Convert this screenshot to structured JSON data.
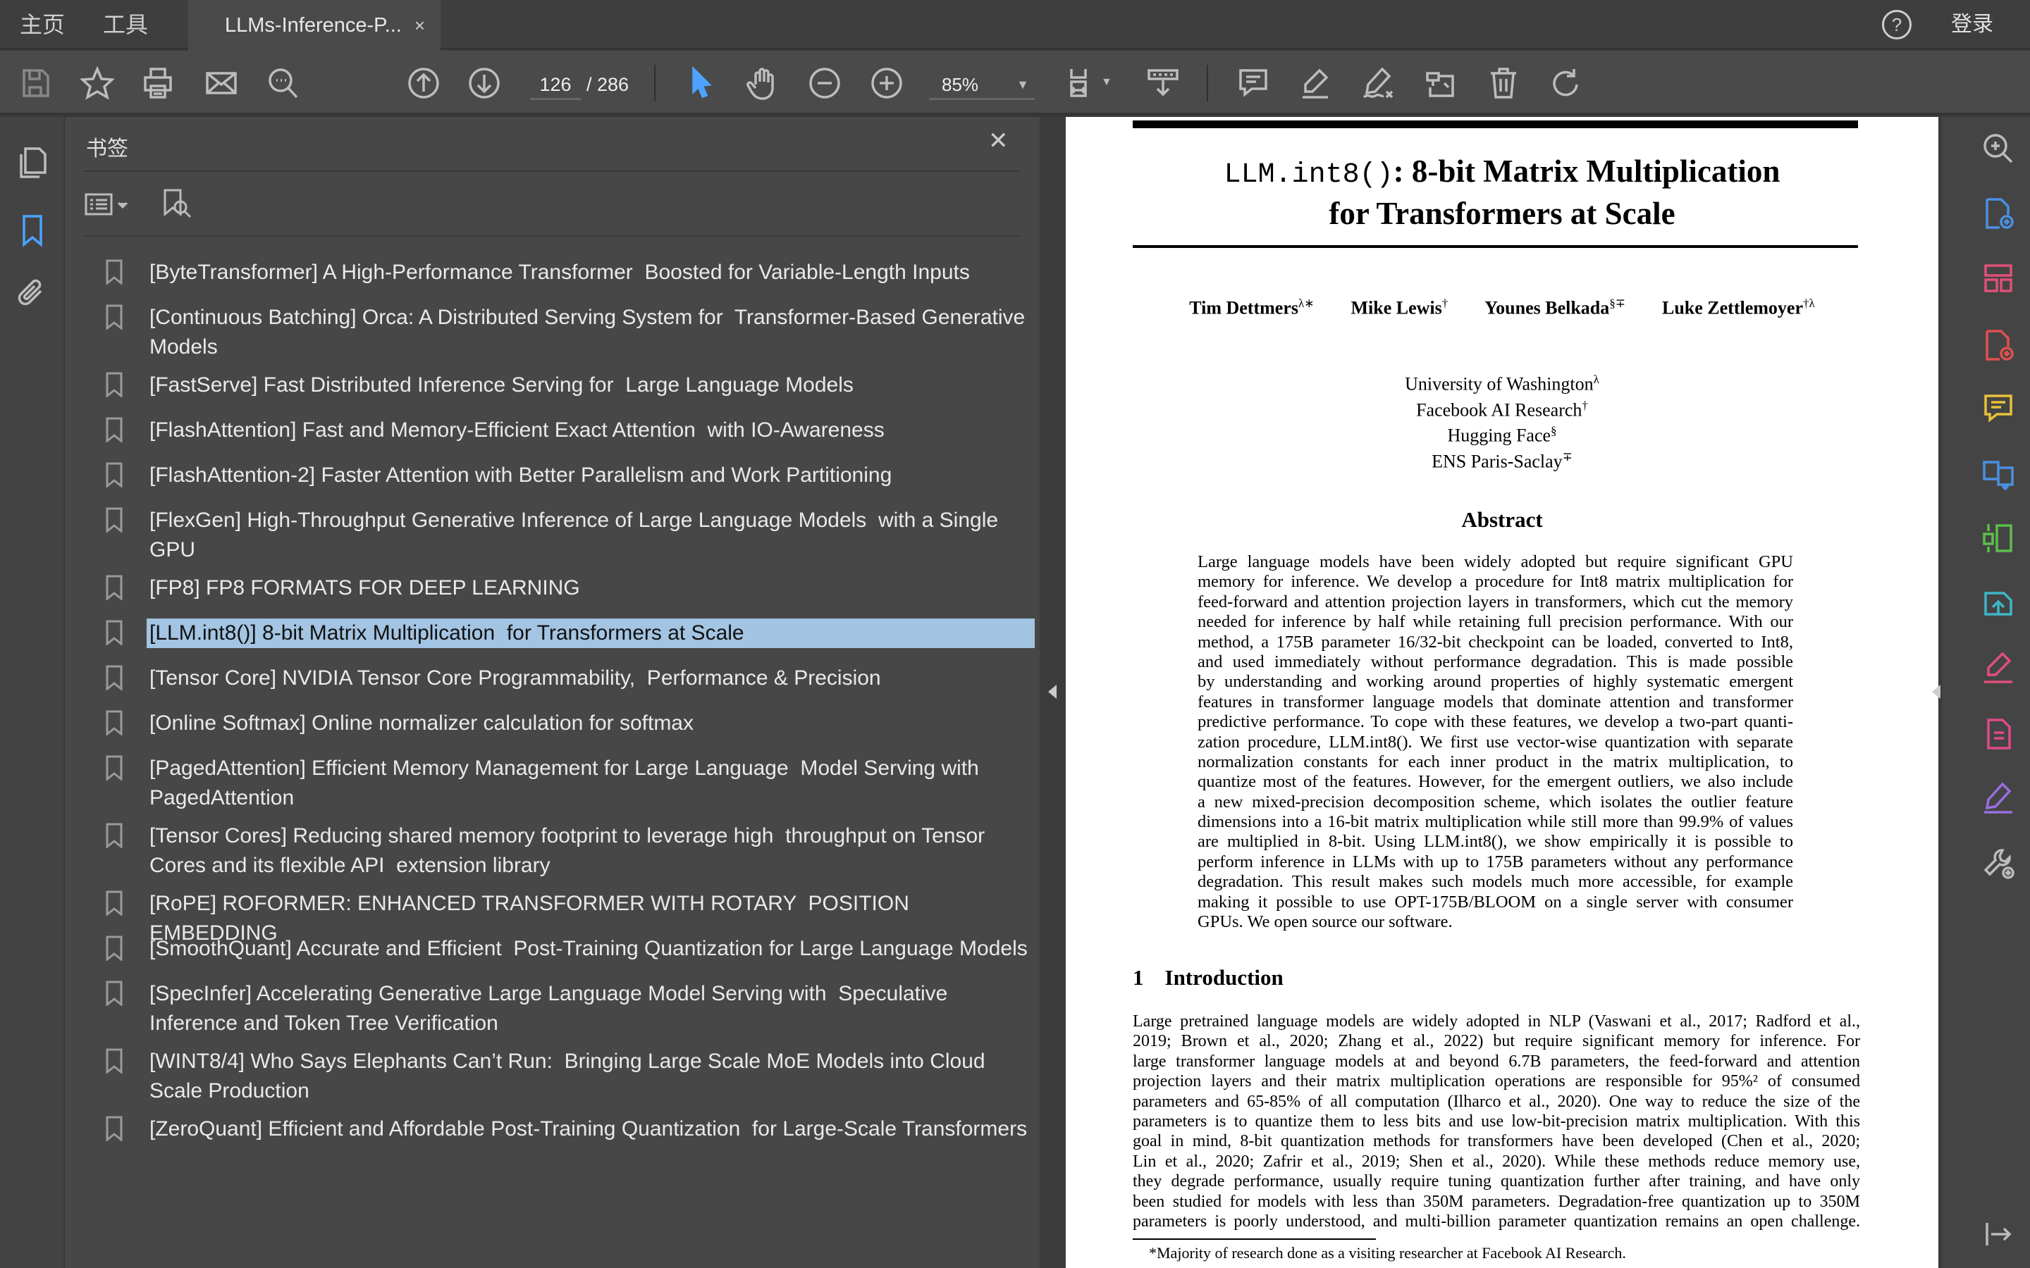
{
  "tabbar": {
    "home": "主页",
    "tools": "工具",
    "doc_tab": "LLMs-Inference-P...",
    "close": "×",
    "login": "登录"
  },
  "toolbar": {
    "page_current": "126",
    "page_total": "/ 286",
    "zoom": "85%"
  },
  "sidebar": {
    "title": "书签",
    "close": "✕",
    "items": [
      {
        "label": "[ByteTransformer] A High-Performance Transformer  Boosted for Variable-Length Inputs"
      },
      {
        "label": "[Continuous Batching] Orca: A Distributed Serving System for  Transformer-Based Generative Models"
      },
      {
        "label": "[FastServe] Fast Distributed Inference Serving for  Large Language Models"
      },
      {
        "label": "[FlashAttention] Fast and Memory-Efficient Exact Attention  with IO-Awareness"
      },
      {
        "label": "[FlashAttention-2] Faster Attention with Better Parallelism and Work Partitioning"
      },
      {
        "label": "[FlexGen] High-Throughput Generative Inference of Large Language Models  with a Single GPU"
      },
      {
        "label": "[FP8] FP8 FORMATS FOR DEEP LEARNING"
      },
      {
        "label": "[LLM.int8()] 8-bit Matrix Multiplication  for Transformers at Scale",
        "selected": true
      },
      {
        "label": "[Tensor Core] NVIDIA Tensor Core Programmability,  Performance & Precision"
      },
      {
        "label": "[Online Softmax] Online normalizer calculation for softmax"
      },
      {
        "label": "[PagedAttention] Efficient Memory Management for Large Language  Model Serving with PagedAttention"
      },
      {
        "label": "[Tensor Cores] Reducing shared memory footprint to leverage high  throughput on Tensor Cores and its flexible API  extension library"
      },
      {
        "label": "[RoPE] ROFORMER: ENHANCED TRANSFORMER WITH ROTARY  POSITION EMBEDDING"
      },
      {
        "label": "[SmoothQuant] Accurate and Efficient  Post-Training Quantization for Large Language Models"
      },
      {
        "label": "[SpecInfer] Accelerating Generative Large Language Model Serving with  Speculative Inference and Token Tree Verification"
      },
      {
        "label": "[WINT8/4] Who Says Elephants Can’t Run:  Bringing Large Scale MoE Models into Cloud Scale Production"
      },
      {
        "label": "[ZeroQuant] Efficient and Affordable Post-Training Quantization  for Large-Scale Transformers"
      }
    ]
  },
  "paper": {
    "title_mono": "LLM.int8()",
    "title_rest": ": 8-bit Matrix Multiplication",
    "title_line2": "for Transformers at Scale",
    "authors": [
      {
        "name": "Tim Dettmers",
        "sup": "λ∗"
      },
      {
        "name": "Mike Lewis",
        "sup": "†"
      },
      {
        "name": "Younes Belkada",
        "sup": "§∓"
      },
      {
        "name": "Luke Zettlemoyer",
        "sup": "†λ"
      }
    ],
    "affiliations": [
      {
        "name": "University of Washington",
        "sup": "λ"
      },
      {
        "name": "Facebook AI Research",
        "sup": "†"
      },
      {
        "name": "Hugging Face",
        "sup": "§"
      },
      {
        "name": "ENS Paris-Saclay",
        "sup": "∓"
      }
    ],
    "abstract_heading": "Abstract",
    "abstract_lines": [
      "Large language models have been widely adopted but require significant GPU",
      "memory for inference. We develop a procedure for Int8 matrix multiplication for",
      "feed-forward and attention projection layers in transformers, which cut the memory",
      "needed for inference by half while retaining full precision performance. With our",
      "method, a 175B parameter 16/32-bit checkpoint can be loaded, converted to Int8,",
      "and used immediately without performance degradation. This is made possible",
      "by understanding and working around properties of highly systematic emergent",
      "features in transformer language models that dominate attention and transformer",
      "predictive performance. To cope with these features, we develop a two-part quanti-",
      "zation procedure, LLM.int8(). We first use vector-wise quantization with separate",
      "normalization constants for each inner product in the matrix multiplication, to",
      "quantize most of the features. However, for the emergent outliers, we also include",
      "a new mixed-precision decomposition scheme, which isolates the outlier feature",
      "dimensions into a 16-bit matrix multiplication while still more than 99.9% of values",
      "are multiplied in 8-bit. Using LLM.int8(), we show empirically it is possible to",
      "perform inference in LLMs with up to 175B parameters without any performance",
      "degradation. This result makes such models much more accessible, for example",
      "making it possible to use OPT-175B/BLOOM on a single server with consumer",
      "GPUs. We open source our software."
    ],
    "intro_number": "1",
    "intro_heading": "Introduction",
    "intro_lines": [
      "Large pretrained language models are widely adopted in NLP (Vaswani et al., 2017; Radford et al.,",
      "2019; Brown et al., 2020; Zhang et al., 2022) but require significant memory for inference. For",
      "large transformer language models at and beyond 6.7B parameters, the feed-forward and attention",
      "projection layers and their matrix multiplication operations are responsible for 95%² of consumed",
      "parameters and 65-85% of all computation (Ilharco et al., 2020). One way to reduce the size of the",
      "parameters is to quantize them to less bits and use low-bit-precision matrix multiplication. With this",
      "goal in mind, 8-bit quantization methods for transformers have been developed (Chen et al., 2020;",
      "Lin et al., 2020; Zafrir et al., 2019; Shen et al., 2020). While these methods reduce memory use,",
      "they degrade performance, usually require tuning quantization further after training, and have only",
      "been studied for models with less than 350M parameters. Degradation-free quantization up to 350M",
      "parameters is poorly understood, and multi-billion parameter quantization remains an open challenge."
    ],
    "footnote": "*Majority of research done as a visiting researcher at Facebook AI Research."
  },
  "colors": {
    "selection": "#a3c4e2",
    "active_tool": "#4da3ff",
    "rail_blue": "#4a90e2",
    "rail_pink": "#e0507a",
    "rail_yellow": "#e8c23a",
    "rail_green": "#5bbf4a",
    "rail_purple": "#9a6ee0"
  }
}
